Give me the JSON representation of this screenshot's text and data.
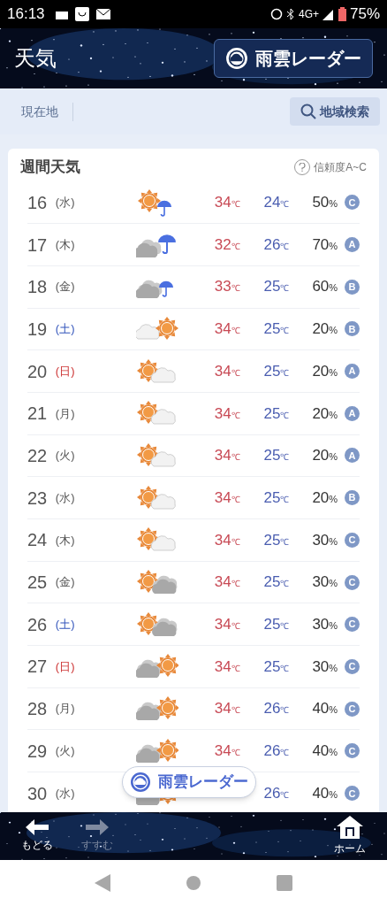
{
  "status_bar": {
    "time": "16:13",
    "network": "4G+",
    "battery": "75%"
  },
  "header": {
    "title": "天気",
    "radar_button": "雨雲レーダー"
  },
  "location_bar": {
    "current": "現在地",
    "search_button": "地域検索"
  },
  "weekly": {
    "title": "週間天気",
    "reliability_label": "信頼度A~C",
    "rows": [
      {
        "date": "16",
        "weekday": "(水)",
        "color": "#555555",
        "kind": "sun-umbrella",
        "high": "34",
        "low": "24",
        "rain": "50",
        "grade": "C"
      },
      {
        "date": "17",
        "weekday": "(木)",
        "color": "#555555",
        "kind": "cloud-umbrella-big",
        "high": "32",
        "low": "26",
        "rain": "70",
        "grade": "A"
      },
      {
        "date": "18",
        "weekday": "(金)",
        "color": "#555555",
        "kind": "cloud-umbrella",
        "high": "33",
        "low": "25",
        "rain": "60",
        "grade": "B"
      },
      {
        "date": "19",
        "weekday": "(土)",
        "color": "#3355bb",
        "kind": "lightcloud-sun",
        "high": "34",
        "low": "25",
        "rain": "20",
        "grade": "B"
      },
      {
        "date": "20",
        "weekday": "(日)",
        "color": "#cc3333",
        "kind": "sun-lightcloud",
        "high": "34",
        "low": "25",
        "rain": "20",
        "grade": "A"
      },
      {
        "date": "21",
        "weekday": "(月)",
        "color": "#555555",
        "kind": "sun-lightcloud",
        "high": "34",
        "low": "25",
        "rain": "20",
        "grade": "A"
      },
      {
        "date": "22",
        "weekday": "(火)",
        "color": "#555555",
        "kind": "sun-lightcloud",
        "high": "34",
        "low": "25",
        "rain": "20",
        "grade": "A"
      },
      {
        "date": "23",
        "weekday": "(水)",
        "color": "#555555",
        "kind": "sun-lightcloud",
        "high": "34",
        "low": "25",
        "rain": "20",
        "grade": "B"
      },
      {
        "date": "24",
        "weekday": "(木)",
        "color": "#555555",
        "kind": "sun-lightcloud",
        "high": "34",
        "low": "25",
        "rain": "30",
        "grade": "C"
      },
      {
        "date": "25",
        "weekday": "(金)",
        "color": "#555555",
        "kind": "sun-cloud",
        "high": "34",
        "low": "25",
        "rain": "30",
        "grade": "C"
      },
      {
        "date": "26",
        "weekday": "(土)",
        "color": "#3355bb",
        "kind": "sun-cloud",
        "high": "34",
        "low": "25",
        "rain": "30",
        "grade": "C"
      },
      {
        "date": "27",
        "weekday": "(日)",
        "color": "#cc3333",
        "kind": "cloud-sun",
        "high": "34",
        "low": "25",
        "rain": "30",
        "grade": "C"
      },
      {
        "date": "28",
        "weekday": "(月)",
        "color": "#555555",
        "kind": "cloud-sun",
        "high": "34",
        "low": "26",
        "rain": "40",
        "grade": "C"
      },
      {
        "date": "29",
        "weekday": "(火)",
        "color": "#555555",
        "kind": "cloud-sun",
        "high": "34",
        "low": "26",
        "rain": "40",
        "grade": "C"
      },
      {
        "date": "30",
        "weekday": "(水)",
        "color": "#555555",
        "kind": "cloud-sun",
        "low": "26",
        "rain": "40",
        "grade": "C"
      }
    ],
    "unit_temp": "℃",
    "unit_rain": "%"
  },
  "floating_button": "雨雲レーダー",
  "bottom_nav": [
    {
      "label": "もどる",
      "kind": "back",
      "disabled": false
    },
    {
      "label": "すすむ",
      "kind": "forward",
      "disabled": true
    },
    {
      "label": "ホーム",
      "kind": "home",
      "disabled": false
    }
  ]
}
